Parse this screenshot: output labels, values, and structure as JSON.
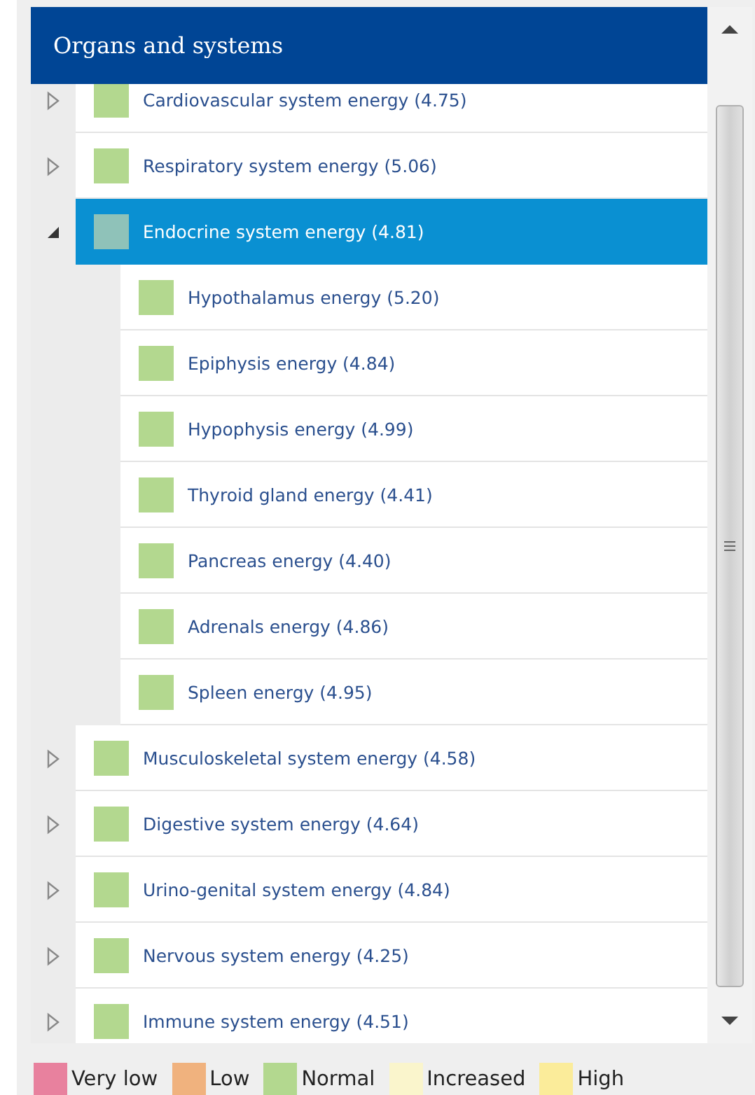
{
  "panel": {
    "title": "Organs and systems"
  },
  "tree": [
    {
      "label": "Cardiovascular system energy (4.75)",
      "color": "#b3d88f",
      "expanded": false,
      "selected": false
    },
    {
      "label": "Respiratory system energy (5.06)",
      "color": "#b3d88f",
      "expanded": false,
      "selected": false
    },
    {
      "label": "Endocrine system energy (4.81)",
      "color": "#8fc2b9",
      "expanded": true,
      "selected": true,
      "children": [
        {
          "label": "Hypothalamus energy (5.20)",
          "color": "#b3d88f",
          "selected": false
        },
        {
          "label": "Epiphysis energy (4.84)",
          "color": "#b3d88f",
          "selected": false
        },
        {
          "label": "Hypophysis energy (4.99)",
          "color": "#b3d88f",
          "selected": false
        },
        {
          "label": "Thyroid gland energy (4.41)",
          "color": "#b3d88f",
          "selected": false
        },
        {
          "label": "Pancreas energy (4.40)",
          "color": "#b3d88f",
          "selected": false
        },
        {
          "label": "Adrenals energy (4.86)",
          "color": "#b3d88f",
          "selected": false
        },
        {
          "label": "Spleen energy (4.95)",
          "color": "#b3d88f",
          "selected": false
        }
      ]
    },
    {
      "label": "Musculoskeletal system energy (4.58)",
      "color": "#b3d88f",
      "expanded": false,
      "selected": false
    },
    {
      "label": "Digestive system energy (4.64)",
      "color": "#b3d88f",
      "expanded": false,
      "selected": false
    },
    {
      "label": "Urino-genital system energy (4.84)",
      "color": "#b3d88f",
      "expanded": false,
      "selected": false
    },
    {
      "label": "Nervous system energy (4.25)",
      "color": "#b3d88f",
      "expanded": false,
      "selected": false
    },
    {
      "label": "Immune system energy (4.51)",
      "color": "#b3d88f",
      "expanded": false,
      "selected": false
    }
  ],
  "legend": [
    {
      "label": "Very low",
      "color": "#e8819e"
    },
    {
      "label": "Low",
      "color": "#f0b27e"
    },
    {
      "label": "Normal",
      "color": "#b3d88f"
    },
    {
      "label": "Increased",
      "color": "#faf5cc"
    },
    {
      "label": "High",
      "color": "#fbec9a"
    }
  ]
}
